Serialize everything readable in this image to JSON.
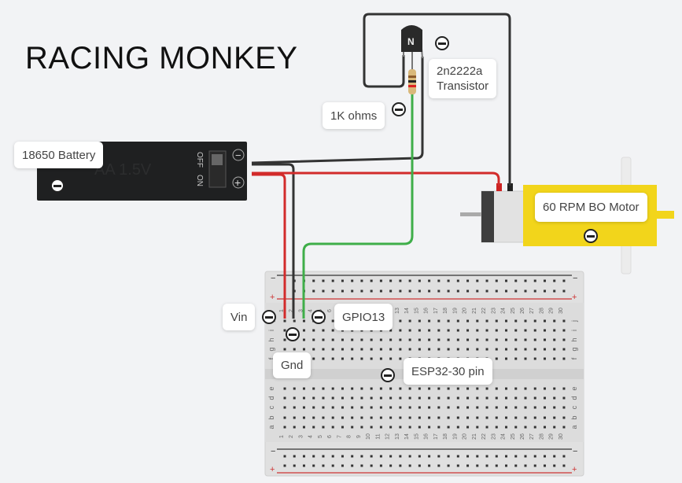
{
  "title": "RACING MONKEY",
  "battery": {
    "label": "18650 Battery",
    "switch_off": "OFF",
    "switch_on": "ON",
    "body_text": "AA 1.5V",
    "minus": "−",
    "plus": "+"
  },
  "transistor": {
    "label_line1": "2n2222a",
    "label_line2": "Transistor",
    "marking": "N"
  },
  "resistor": {
    "label": "1K ohms"
  },
  "motor": {
    "label": "60 RPM BO Motor"
  },
  "breadboard": {
    "label": "ESP32-30 pin",
    "rows_top": [
      "j",
      "i",
      "h",
      "g",
      "f"
    ],
    "rows_bottom": [
      "e",
      "d",
      "c",
      "b",
      "a"
    ],
    "columns": 30,
    "rail_minus": "−",
    "rail_plus": "+"
  },
  "pins": {
    "vin": "Vin",
    "gnd": "Gnd",
    "gpio": "GPIO13"
  },
  "colors": {
    "wire_red": "#d22b2b",
    "wire_black": "#333333",
    "wire_green": "#3fae49",
    "motor_yellow": "#f2d51b",
    "battery": "#1f2021",
    "breadboard": "#dedede"
  }
}
